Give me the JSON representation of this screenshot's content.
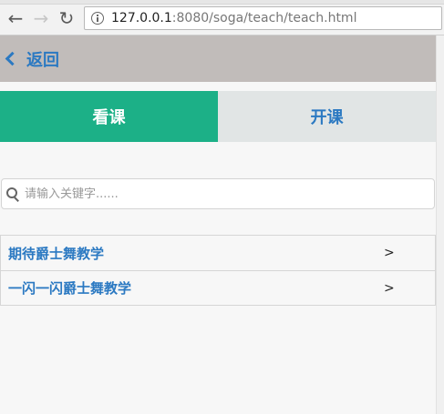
{
  "browser": {
    "nav": {
      "back_icon": "←",
      "forward_icon": "→",
      "reload_icon": "↻"
    },
    "address": {
      "host": "127.0.0.1",
      "rest": ":8080/soga/teach/teach.html"
    }
  },
  "header": {
    "back_label": "返回"
  },
  "tabs": [
    {
      "label": "看课"
    },
    {
      "label": "开课"
    }
  ],
  "search": {
    "placeholder": "请输入关键字......",
    "value": ""
  },
  "courses": [
    {
      "title": "期待爵士舞教学",
      "arrow": ">"
    },
    {
      "title": "一闪一闪爵士舞教学",
      "arrow": ">"
    }
  ],
  "colors": {
    "header_bg": "#c1bcba",
    "active_tab": "#1cb087",
    "inactive_tab": "#e1e5e5",
    "link_blue": "#2b79c2"
  }
}
